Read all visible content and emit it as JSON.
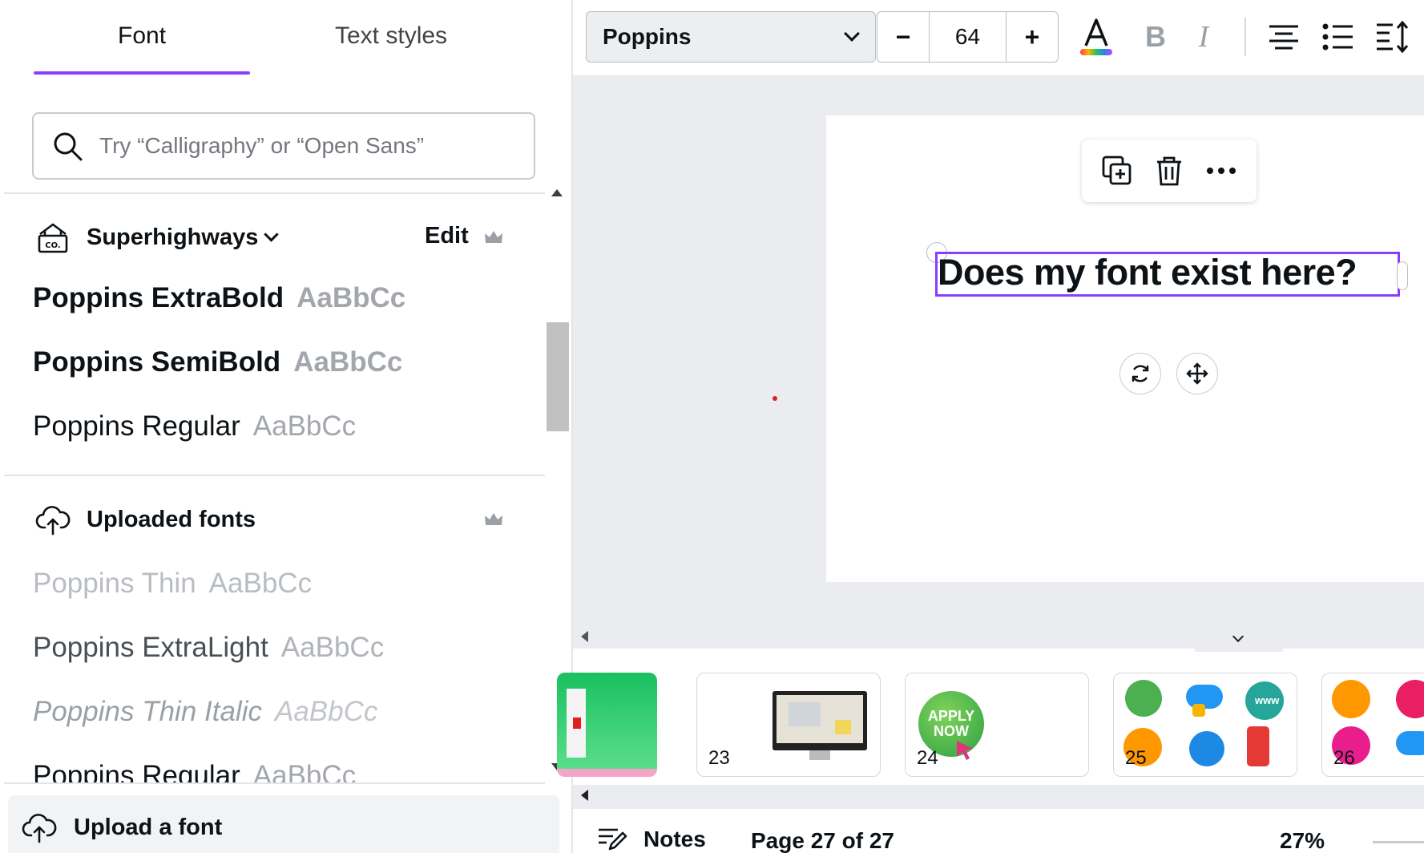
{
  "panel": {
    "tabs": [
      {
        "label": "Font",
        "active": true
      },
      {
        "label": "Text styles",
        "active": false
      }
    ],
    "search": {
      "placeholder": "Try “Calligraphy” or “Open Sans”"
    },
    "brand_kit": {
      "name": "Superhighways",
      "edit_label": "Edit",
      "fonts": [
        {
          "name": "Poppins ExtraBold",
          "sample": "AaBbCc"
        },
        {
          "name": "Poppins SemiBold",
          "sample": "AaBbCc"
        },
        {
          "name": "Poppins Regular",
          "sample": "AaBbCc"
        }
      ]
    },
    "uploaded": {
      "title": "Uploaded fonts",
      "fonts": [
        {
          "name": "Poppins Thin",
          "sample": "AaBbCc"
        },
        {
          "name": "Poppins ExtraLight",
          "sample": "AaBbCc"
        },
        {
          "name": "Poppins Thin Italic",
          "sample": "AaBbCc"
        },
        {
          "name": "Poppins Regular",
          "sample": "AaBbCc"
        }
      ]
    },
    "upload_button": "Upload a font"
  },
  "toolbar": {
    "font_name": "Poppins",
    "font_size": "64",
    "decrease": "−",
    "increase": "+",
    "accent": "#8b3dff"
  },
  "canvas": {
    "text": "Does my font exist here?"
  },
  "thumbnails": [
    {
      "num": ""
    },
    {
      "num": "23"
    },
    {
      "num": "24",
      "label": "APPLY NOW"
    },
    {
      "num": "25"
    },
    {
      "num": "26"
    }
  ],
  "footer": {
    "notes": "Notes",
    "page_indicator": "Page 27 of 27",
    "zoom": "27%"
  }
}
